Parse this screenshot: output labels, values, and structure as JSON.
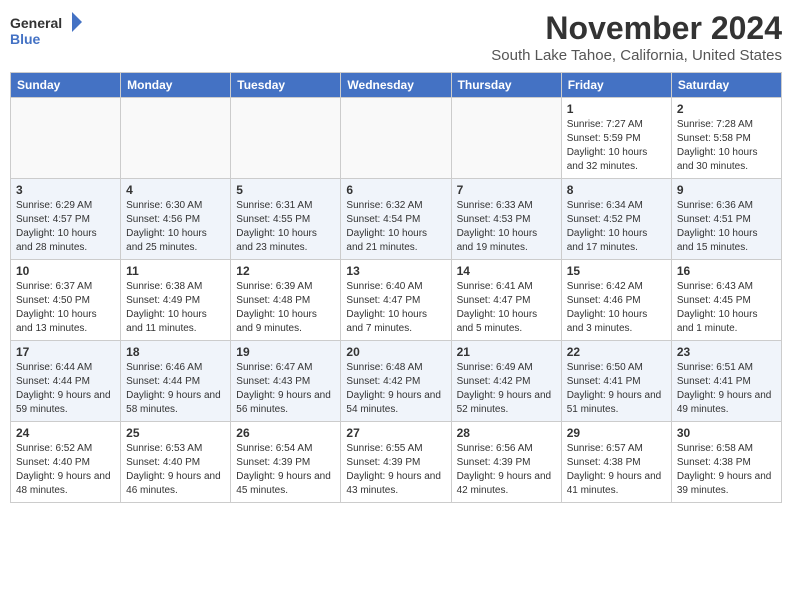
{
  "header": {
    "logo_line1": "General",
    "logo_line2": "Blue",
    "month": "November 2024",
    "location": "South Lake Tahoe, California, United States"
  },
  "weekdays": [
    "Sunday",
    "Monday",
    "Tuesday",
    "Wednesday",
    "Thursday",
    "Friday",
    "Saturday"
  ],
  "weeks": [
    [
      {
        "day": "",
        "info": ""
      },
      {
        "day": "",
        "info": ""
      },
      {
        "day": "",
        "info": ""
      },
      {
        "day": "",
        "info": ""
      },
      {
        "day": "",
        "info": ""
      },
      {
        "day": "1",
        "info": "Sunrise: 7:27 AM\nSunset: 5:59 PM\nDaylight: 10 hours and 32 minutes."
      },
      {
        "day": "2",
        "info": "Sunrise: 7:28 AM\nSunset: 5:58 PM\nDaylight: 10 hours and 30 minutes."
      }
    ],
    [
      {
        "day": "3",
        "info": "Sunrise: 6:29 AM\nSunset: 4:57 PM\nDaylight: 10 hours and 28 minutes."
      },
      {
        "day": "4",
        "info": "Sunrise: 6:30 AM\nSunset: 4:56 PM\nDaylight: 10 hours and 25 minutes."
      },
      {
        "day": "5",
        "info": "Sunrise: 6:31 AM\nSunset: 4:55 PM\nDaylight: 10 hours and 23 minutes."
      },
      {
        "day": "6",
        "info": "Sunrise: 6:32 AM\nSunset: 4:54 PM\nDaylight: 10 hours and 21 minutes."
      },
      {
        "day": "7",
        "info": "Sunrise: 6:33 AM\nSunset: 4:53 PM\nDaylight: 10 hours and 19 minutes."
      },
      {
        "day": "8",
        "info": "Sunrise: 6:34 AM\nSunset: 4:52 PM\nDaylight: 10 hours and 17 minutes."
      },
      {
        "day": "9",
        "info": "Sunrise: 6:36 AM\nSunset: 4:51 PM\nDaylight: 10 hours and 15 minutes."
      }
    ],
    [
      {
        "day": "10",
        "info": "Sunrise: 6:37 AM\nSunset: 4:50 PM\nDaylight: 10 hours and 13 minutes."
      },
      {
        "day": "11",
        "info": "Sunrise: 6:38 AM\nSunset: 4:49 PM\nDaylight: 10 hours and 11 minutes."
      },
      {
        "day": "12",
        "info": "Sunrise: 6:39 AM\nSunset: 4:48 PM\nDaylight: 10 hours and 9 minutes."
      },
      {
        "day": "13",
        "info": "Sunrise: 6:40 AM\nSunset: 4:47 PM\nDaylight: 10 hours and 7 minutes."
      },
      {
        "day": "14",
        "info": "Sunrise: 6:41 AM\nSunset: 4:47 PM\nDaylight: 10 hours and 5 minutes."
      },
      {
        "day": "15",
        "info": "Sunrise: 6:42 AM\nSunset: 4:46 PM\nDaylight: 10 hours and 3 minutes."
      },
      {
        "day": "16",
        "info": "Sunrise: 6:43 AM\nSunset: 4:45 PM\nDaylight: 10 hours and 1 minute."
      }
    ],
    [
      {
        "day": "17",
        "info": "Sunrise: 6:44 AM\nSunset: 4:44 PM\nDaylight: 9 hours and 59 minutes."
      },
      {
        "day": "18",
        "info": "Sunrise: 6:46 AM\nSunset: 4:44 PM\nDaylight: 9 hours and 58 minutes."
      },
      {
        "day": "19",
        "info": "Sunrise: 6:47 AM\nSunset: 4:43 PM\nDaylight: 9 hours and 56 minutes."
      },
      {
        "day": "20",
        "info": "Sunrise: 6:48 AM\nSunset: 4:42 PM\nDaylight: 9 hours and 54 minutes."
      },
      {
        "day": "21",
        "info": "Sunrise: 6:49 AM\nSunset: 4:42 PM\nDaylight: 9 hours and 52 minutes."
      },
      {
        "day": "22",
        "info": "Sunrise: 6:50 AM\nSunset: 4:41 PM\nDaylight: 9 hours and 51 minutes."
      },
      {
        "day": "23",
        "info": "Sunrise: 6:51 AM\nSunset: 4:41 PM\nDaylight: 9 hours and 49 minutes."
      }
    ],
    [
      {
        "day": "24",
        "info": "Sunrise: 6:52 AM\nSunset: 4:40 PM\nDaylight: 9 hours and 48 minutes."
      },
      {
        "day": "25",
        "info": "Sunrise: 6:53 AM\nSunset: 4:40 PM\nDaylight: 9 hours and 46 minutes."
      },
      {
        "day": "26",
        "info": "Sunrise: 6:54 AM\nSunset: 4:39 PM\nDaylight: 9 hours and 45 minutes."
      },
      {
        "day": "27",
        "info": "Sunrise: 6:55 AM\nSunset: 4:39 PM\nDaylight: 9 hours and 43 minutes."
      },
      {
        "day": "28",
        "info": "Sunrise: 6:56 AM\nSunset: 4:39 PM\nDaylight: 9 hours and 42 minutes."
      },
      {
        "day": "29",
        "info": "Sunrise: 6:57 AM\nSunset: 4:38 PM\nDaylight: 9 hours and 41 minutes."
      },
      {
        "day": "30",
        "info": "Sunrise: 6:58 AM\nSunset: 4:38 PM\nDaylight: 9 hours and 39 minutes."
      }
    ]
  ]
}
